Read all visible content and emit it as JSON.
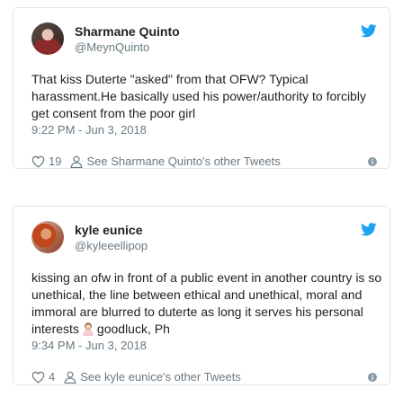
{
  "tweets": [
    {
      "display_name": "Sharmane Quinto",
      "handle": "@MeynQuinto",
      "text": "That kiss Duterte \"asked\" from that OFW? Typical harassment.He basically used his power/authority to forcibly get consent from the poor girl",
      "timestamp": "9:22 PM - Jun 3, 2018",
      "likes": "19",
      "other_tweets_link": "See Sharmane Quinto's other Tweets"
    },
    {
      "display_name": "kyle eunice",
      "handle": "@kyleeellipop",
      "text_before_emoji": "kissing an ofw in front of a public event in another country is so unethical, the line between ethical and unethical, moral and immoral are blurred to duterte as long it serves his personal interests",
      "text_after_emoji": "goodluck, Ph",
      "timestamp": "9:34 PM - Jun 3, 2018",
      "likes": "4",
      "other_tweets_link": "See kyle eunice's other Tweets"
    }
  ],
  "colors": {
    "twitter_blue": "#1da1f2",
    "text": "#1c2022",
    "muted": "#697882",
    "border": "#e1e8ed"
  },
  "icons": [
    "twitter-bird-icon",
    "heart-icon",
    "person-icon",
    "info-icon",
    "woman-gesturing-no-emoji"
  ]
}
